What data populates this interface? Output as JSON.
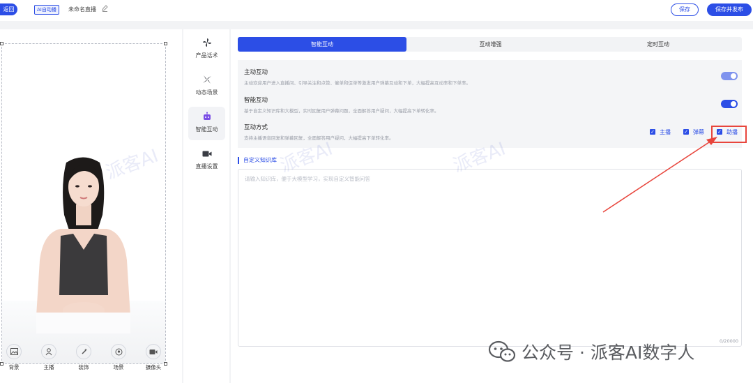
{
  "topbar": {
    "back_label": "返回",
    "mode_tag": "AI自动播",
    "title": "未命名直播",
    "save_label": "保存",
    "publish_label": "保存并发布"
  },
  "preview": {
    "tools": [
      {
        "label": "背景",
        "icon": "image-icon"
      },
      {
        "label": "主播",
        "icon": "anchor-icon"
      },
      {
        "label": "装饰",
        "icon": "sparkle-icon"
      },
      {
        "label": "场景",
        "icon": "scene-icon"
      },
      {
        "label": "摄像头",
        "icon": "camera-icon"
      }
    ]
  },
  "nav": {
    "items": [
      {
        "label": "产品话术",
        "icon": "pinwheel-icon"
      },
      {
        "label": "动态场景",
        "icon": "windmill-icon"
      },
      {
        "label": "智能互动",
        "icon": "robot-icon"
      },
      {
        "label": "直播设置",
        "icon": "video-camera-icon"
      }
    ]
  },
  "tabs": [
    {
      "label": "智能互动"
    },
    {
      "label": "互动增强"
    },
    {
      "label": "定时互动"
    }
  ],
  "settings": {
    "active": {
      "title": "主动互动",
      "desc": "主动欢迎用户进入直播间、引导关注和点赞、催单和促单等激发用户弹幕互动和下单，大幅提高互动率和下单率。"
    },
    "smart": {
      "title": "智能互动",
      "desc": "基于自定义知识库和大模型，实时回复用户弹幕问题，全面解答用户疑问，大幅提高下单转化率。"
    },
    "mode": {
      "title": "互动方式",
      "desc": "支持主播语音回复和弹幕回复，全面解答用户疑问，大幅提高下单转化率。",
      "options": [
        "主播",
        "弹幕",
        "助播"
      ]
    }
  },
  "knowledge": {
    "header": "自定义知识库",
    "placeholder": "请输入知识库，便于大模型学习，实现自定义智能问答",
    "count": "0/20000"
  },
  "watermark": {
    "text": "派客AI",
    "brand": "公众号 · 派客AI数字人"
  },
  "colors": {
    "accent": "#2c4ee6",
    "highlight": "#e8453c"
  }
}
